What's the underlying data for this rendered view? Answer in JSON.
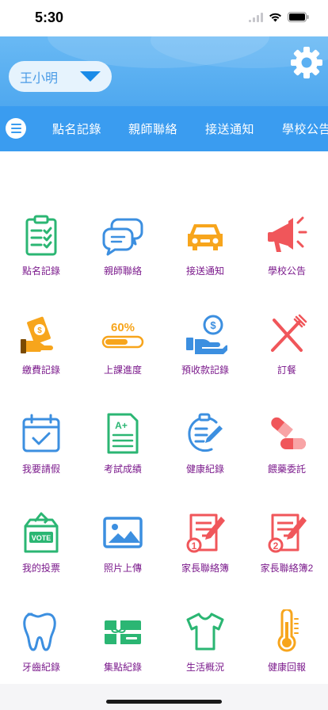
{
  "status_bar": {
    "time": "5:30"
  },
  "header": {
    "student_name": "王小明"
  },
  "nav": {
    "tabs": [
      "點名記錄",
      "親師聯絡",
      "接送通知",
      "學校公告"
    ]
  },
  "grid": {
    "items": [
      {
        "label": "點名記錄",
        "icon": "clipboard-checklist-icon",
        "color": "#2bb673"
      },
      {
        "label": "親師聯絡",
        "icon": "chat-bubbles-icon",
        "color": "#3c8fe0"
      },
      {
        "label": "接送通知",
        "icon": "car-icon",
        "color": "#f7a51c"
      },
      {
        "label": "學校公告",
        "icon": "megaphone-icon",
        "color": "#f0565a"
      },
      {
        "label": "繳費記錄",
        "icon": "money-hand-icon",
        "color": "#f7a51c"
      },
      {
        "label": "上課進度",
        "icon": "progress-bar-icon",
        "color": "#f7a51c"
      },
      {
        "label": "預收款記錄",
        "icon": "prepaid-coin-hand-icon",
        "color": "#3c8fe0"
      },
      {
        "label": "訂餐",
        "icon": "fork-knife-icon",
        "color": "#f0565a"
      },
      {
        "label": "我要請假",
        "icon": "calendar-check-icon",
        "color": "#3c8fe0"
      },
      {
        "label": "考試成績",
        "icon": "grade-sheet-icon",
        "color": "#2bb673"
      },
      {
        "label": "健康紀錄",
        "icon": "health-clipboard-icon",
        "color": "#3c8fe0"
      },
      {
        "label": "餵藥委託",
        "icon": "pill-capsule-icon",
        "color": "#f0565a"
      },
      {
        "label": "我的投票",
        "icon": "vote-box-icon",
        "color": "#2bb673"
      },
      {
        "label": "照片上傳",
        "icon": "photo-icon",
        "color": "#3c8fe0"
      },
      {
        "label": "家長聯絡簿",
        "icon": "contact-book-1-icon",
        "color": "#f0565a"
      },
      {
        "label": "家長聯絡簿2",
        "icon": "contact-book-2-icon",
        "color": "#f0565a"
      },
      {
        "label": "牙齒紀錄",
        "icon": "tooth-icon",
        "color": "#3c8fe0"
      },
      {
        "label": "集點紀錄",
        "icon": "gift-card-icon",
        "color": "#2bb673"
      },
      {
        "label": "生活概況",
        "icon": "tshirt-icon",
        "color": "#2bb673"
      },
      {
        "label": "健康回報",
        "icon": "thermometer-icon",
        "color": "#f7a51c"
      }
    ],
    "progress_icon_text": "60%",
    "vote_icon_text": "VOTE",
    "grade_icon_text": "A+"
  }
}
